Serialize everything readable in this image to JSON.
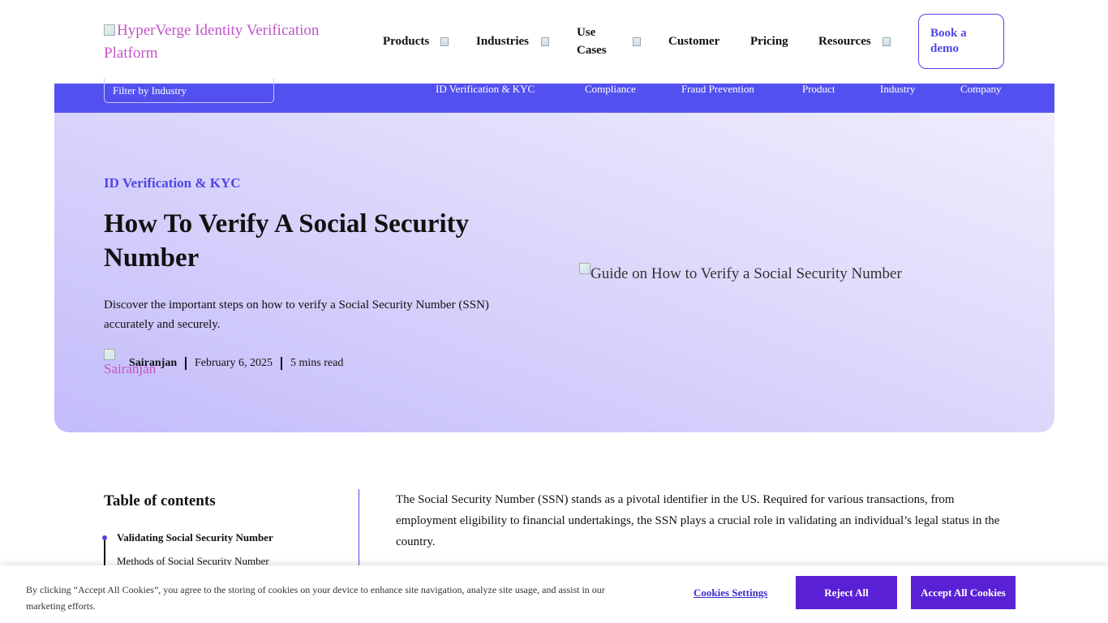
{
  "header": {
    "logo_alt": "HyperVerge Identity Verification Platform",
    "nav": [
      {
        "label": "Products",
        "has_dropdown": true
      },
      {
        "label": "Industries",
        "has_dropdown": true
      },
      {
        "label": "Use Cases",
        "has_dropdown": true
      },
      {
        "label": "Customer",
        "has_dropdown": false
      },
      {
        "label": "Pricing",
        "has_dropdown": false
      },
      {
        "label": "Resources",
        "has_dropdown": true
      }
    ],
    "demo_button": "Book a demo"
  },
  "category_bar": {
    "filter_label": "Filter by Industry",
    "links": [
      "ID Verification & KYC",
      "Compliance",
      "Fraud Prevention",
      "Product",
      "Industry",
      "Company"
    ]
  },
  "hero": {
    "category": "ID Verification & KYC",
    "title": "How To Verify A Social Security Number",
    "description": "Discover the important steps on how to verify a Social Security Number (SSN) accurately and securely.",
    "author": "Sairanjan",
    "author_avatar_alt": "Sairanjan",
    "date": "February 6, 2025",
    "read_time": "5 mins read",
    "image_alt": "Guide on How to Verify a Social Security Number"
  },
  "toc": {
    "title": "Table of contents",
    "items": [
      "Validating Social Security Number",
      "Methods of Social Security Number"
    ]
  },
  "article": {
    "intro": "The Social Security Number (SSN) stands as a pivotal identifier in the US. Required for various transactions, from employment eligibility to financial undertakings, the SSN plays a crucial role in validating an individual’s legal status in the country."
  },
  "cookie_banner": {
    "text": "By clicking “Accept All Cookies”, you agree to the storing of cookies on your device to enhance site navigation, analyze site usage, and assist in our marketing efforts.",
    "settings_label": "Cookies Settings",
    "reject_label": "Reject All",
    "accept_label": "Accept All Cookies"
  },
  "colors": {
    "brand": "#4f46e5",
    "category_bar": "#5350f0",
    "cookie_button": "#5a20d6",
    "logo_alt_text": "#c254c9"
  }
}
